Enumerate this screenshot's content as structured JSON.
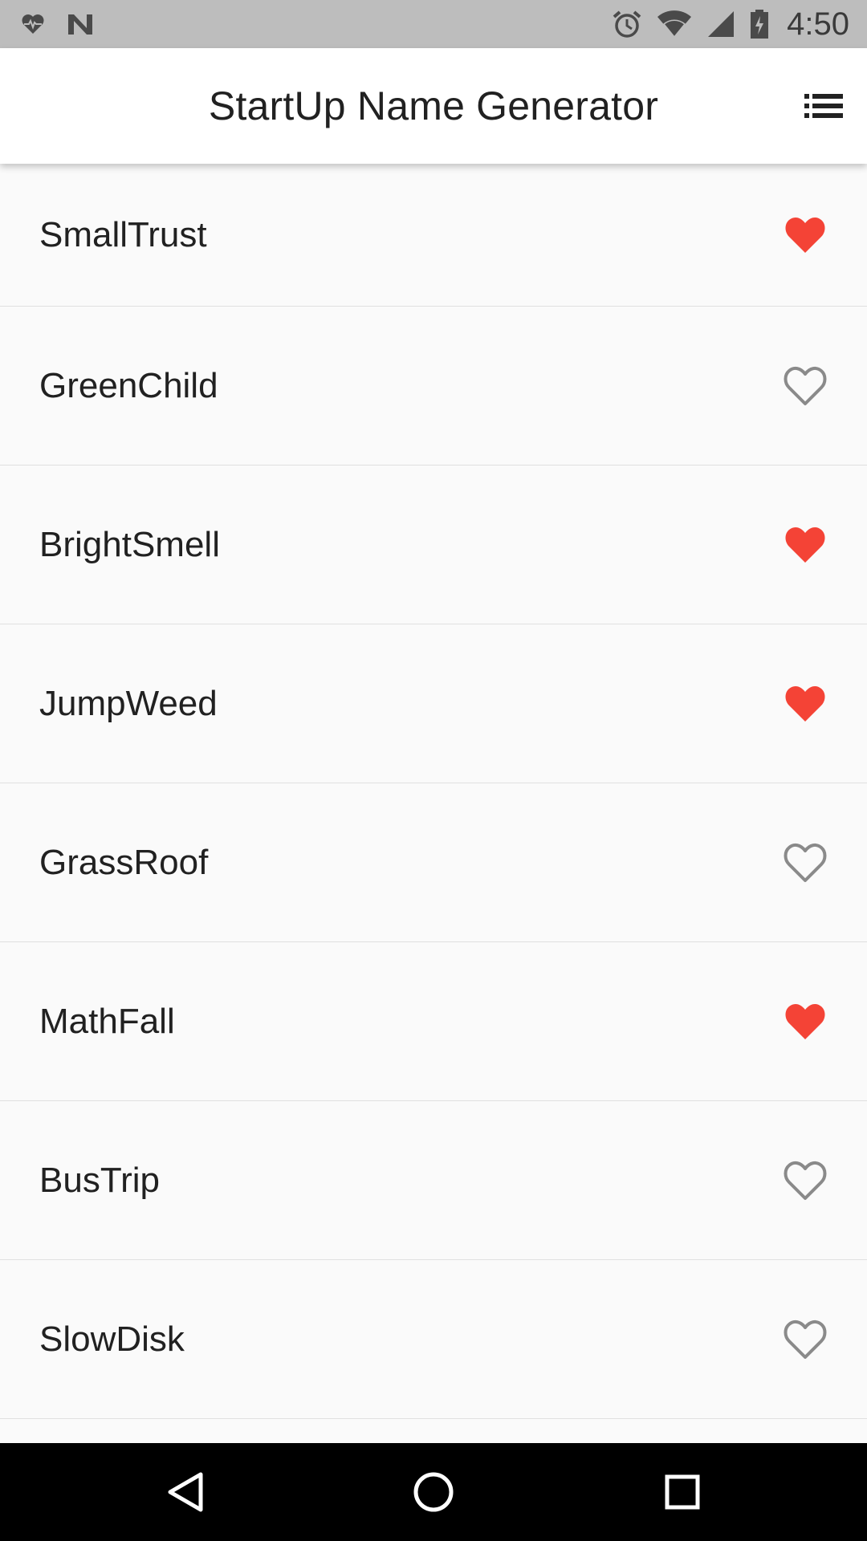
{
  "status_bar": {
    "time": "4:50",
    "icons": [
      "health-icon",
      "n-icon",
      "alarm-icon",
      "wifi-icon",
      "signal-icon",
      "battery-icon"
    ]
  },
  "app_bar": {
    "title": "StartUp Name Generator",
    "action_icon": "list-icon"
  },
  "colors": {
    "favorite": "#f44336",
    "not_favorite": "#8a8a8a",
    "background": "#fafafa"
  },
  "rows": [
    {
      "name": "SmallTrust",
      "favorited": true
    },
    {
      "name": "GreenChild",
      "favorited": false
    },
    {
      "name": "BrightSmell",
      "favorited": true
    },
    {
      "name": "JumpWeed",
      "favorited": true
    },
    {
      "name": "GrassRoof",
      "favorited": false
    },
    {
      "name": "MathFall",
      "favorited": true
    },
    {
      "name": "BusTrip",
      "favorited": false
    },
    {
      "name": "SlowDisk",
      "favorited": false
    }
  ],
  "nav_bar": {
    "icons": [
      "back-icon",
      "home-icon",
      "recents-icon"
    ]
  }
}
